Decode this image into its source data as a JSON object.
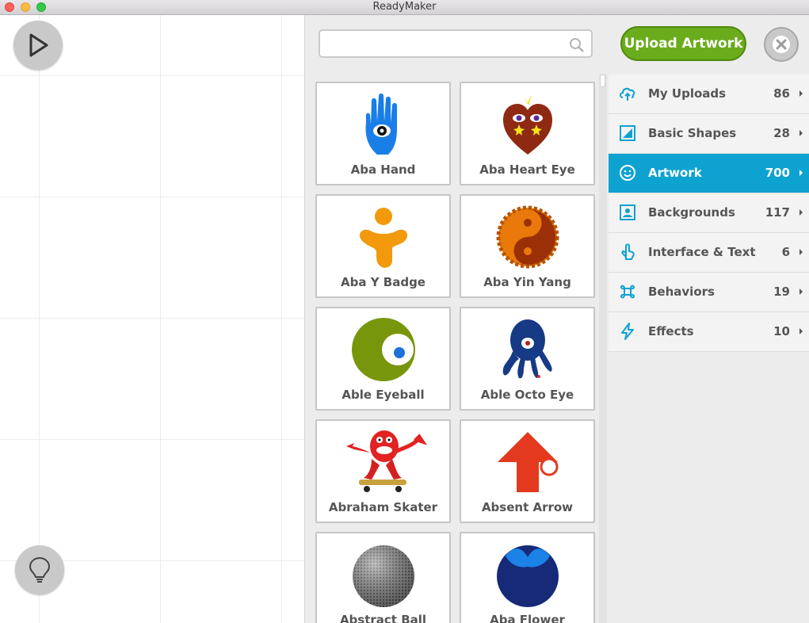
{
  "window": {
    "title": "ReadyMaker"
  },
  "search": {
    "value": "",
    "placeholder": ""
  },
  "toolbar": {
    "upload_label": "Upload Artwork"
  },
  "artworks": [
    {
      "name": "Aba Hand",
      "icon": "blue-hand-eye"
    },
    {
      "name": "Aba Heart Eye",
      "icon": "heart-eye"
    },
    {
      "name": "Aba Y Badge",
      "icon": "orange-y-badge"
    },
    {
      "name": "Aba Yin Yang",
      "icon": "yin-yang"
    },
    {
      "name": "Able Eyeball",
      "icon": "green-eyeball"
    },
    {
      "name": "Able Octo Eye",
      "icon": "octopus-eye"
    },
    {
      "name": "Abraham Skater",
      "icon": "red-skater"
    },
    {
      "name": "Absent Arrow",
      "icon": "red-arrow"
    },
    {
      "name": "Abstract Ball",
      "icon": "mesh-ball"
    },
    {
      "name": "Aba Flower",
      "icon": "blue-flower"
    }
  ],
  "categories": [
    {
      "label": "My Uploads",
      "count": "86",
      "icon": "upload-cloud-icon",
      "active": false
    },
    {
      "label": "Basic Shapes",
      "count": "28",
      "icon": "shapes-icon",
      "active": false
    },
    {
      "label": "Artwork",
      "count": "700",
      "icon": "smiley-icon",
      "active": true
    },
    {
      "label": "Backgrounds",
      "count": "117",
      "icon": "image-icon",
      "active": false
    },
    {
      "label": "Interface & Text",
      "count": "6",
      "icon": "touch-icon",
      "active": false
    },
    {
      "label": "Behaviors",
      "count": "19",
      "icon": "command-icon",
      "active": false
    },
    {
      "label": "Effects",
      "count": "10",
      "icon": "lightning-icon",
      "active": false
    }
  ],
  "colors": {
    "accent": "#0ea2d1",
    "upload": "#6bac1c",
    "panel": "#ececec"
  }
}
